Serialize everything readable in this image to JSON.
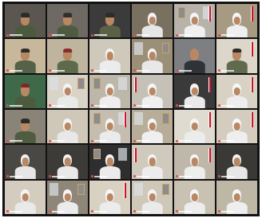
{
  "meeting": {
    "grid_columns": 6,
    "grid_rows": 6
  },
  "participants": [
    {
      "attire": "military-cap",
      "bg": "#5b5750",
      "body": "#4b5a3c",
      "head": "#2b2d28",
      "tag_visible": true
    },
    {
      "attire": "military-cap",
      "bg": "#6e6a63",
      "body": "#4f5b40",
      "head": "#2f312b",
      "tag_visible": true
    },
    {
      "attire": "military-cap",
      "bg": "#3b3b3b",
      "body": "#5a6146",
      "head": "#2c2b28",
      "tag_visible": true
    },
    {
      "attire": "ghutra-white",
      "bg": "#7a7060",
      "body": "#e6e6e6",
      "head": "#f2f2f2",
      "tag_visible": true
    },
    {
      "attire": "ghutra-white",
      "bg": "#b8b3aa",
      "body": "#f0f0f0",
      "head": "#f5f5f5",
      "tag_visible": true
    },
    {
      "attire": "ghutra-white",
      "bg": "#a79a83",
      "body": "#efefef",
      "head": "#f4f4f4",
      "tag_visible": true
    },
    {
      "attire": "military-cap",
      "bg": "#c7b89b",
      "body": "#566247",
      "head": "#2d2e2a",
      "tag_visible": true
    },
    {
      "attire": "military-cap",
      "bg": "#bfb59f",
      "body": "#5d6a4b",
      "head": "#8a2a2a",
      "tag_visible": true
    },
    {
      "attire": "ghutra-white",
      "bg": "#cfc9bc",
      "body": "#ececec",
      "head": "#f4f4f4",
      "tag_visible": true
    },
    {
      "attire": "ghutra-white",
      "bg": "#9c8f77",
      "body": "#e8e8e8",
      "head": "#f6f6f6",
      "tag_visible": true
    },
    {
      "attire": "suit",
      "bg": "#7d7f82",
      "body": "#2f3338",
      "head": "#3a3330",
      "tag_visible": true
    },
    {
      "attire": "military-cap",
      "bg": "#ddd6ca",
      "body": "#5f6b4c",
      "head": "#2b2c28",
      "tag_visible": true
    },
    {
      "attire": "military-cap",
      "bg": "#3f6a4a",
      "body": "#4c5a3e",
      "head": "#7b2a2a",
      "tag_visible": true
    },
    {
      "attire": "ghutra-white",
      "bg": "#d9d3c8",
      "body": "#e9e9e9",
      "head": "#f3f3f3",
      "tag_visible": true
    },
    {
      "attire": "ghutra-white",
      "bg": "#bdb7aa",
      "body": "#eeeeee",
      "head": "#f5f5f5",
      "tag_visible": true
    },
    {
      "attire": "ghutra-white",
      "bg": "#c6c1b6",
      "body": "#efefef",
      "head": "#f6f6f6",
      "tag_visible": true
    },
    {
      "attire": "ghutra-white",
      "bg": "#3a3a3a",
      "body": "#eaeaea",
      "head": "#f4f4f4",
      "tag_visible": true
    },
    {
      "attire": "ghutra-white",
      "bg": "#d8d2c4",
      "body": "#ededed",
      "head": "#f6f6f6",
      "tag_visible": true
    },
    {
      "attire": "military-cap",
      "bg": "#8a8478",
      "body": "#4f5c40",
      "head": "#2b2c28",
      "tag_visible": true
    },
    {
      "attire": "ghutra-white",
      "bg": "#cfc8b8",
      "body": "#e8e8e8",
      "head": "#f4f4f4",
      "tag_visible": true
    },
    {
      "attire": "ghutra-white",
      "bg": "#c4bdb0",
      "body": "#ebebeb",
      "head": "#f5f5f5",
      "tag_visible": true
    },
    {
      "attire": "ghutra-white",
      "bg": "#b8ad98",
      "body": "#efefef",
      "head": "#f6f6f6",
      "tag_visible": true
    },
    {
      "attire": "ghutra-white",
      "bg": "#e0dbd0",
      "body": "#ececec",
      "head": "#f5f5f5",
      "tag_visible": true
    },
    {
      "attire": "ghutra-white",
      "bg": "#d3ccbf",
      "body": "#eeeeee",
      "head": "#f6f6f6",
      "tag_visible": true
    },
    {
      "attire": "ghutra-white",
      "bg": "#4a4844",
      "body": "#e6e6e6",
      "head": "#f2f2f2",
      "tag_visible": true
    },
    {
      "attire": "ghutra-white",
      "bg": "#3d3b38",
      "body": "#e9e9e9",
      "head": "#f3f3f3",
      "tag_visible": true
    },
    {
      "attire": "ghutra-white",
      "bg": "#2e2e2e",
      "body": "#ebebeb",
      "head": "#f5f5f5",
      "tag_visible": true
    },
    {
      "attire": "ghutra-white",
      "bg": "#cfc9be",
      "body": "#ececec",
      "head": "#f4f4f4",
      "tag_visible": true
    },
    {
      "attire": "ghutra-white",
      "bg": "#bfb8aa",
      "body": "#eeeeee",
      "head": "#f6f6f6",
      "tag_visible": true
    },
    {
      "attire": "ghutra-white",
      "bg": "#3a3936",
      "body": "#e7e7e7",
      "head": "#f3f3f3",
      "tag_visible": true
    },
    {
      "attire": "ghutra-white",
      "bg": "#d4cdbf",
      "body": "#e9e9e9",
      "head": "#f4f4f4",
      "tag_visible": true
    },
    {
      "attire": "ghutra-white",
      "bg": "#8e8678",
      "body": "#ebebeb",
      "head": "#f5f5f5",
      "tag_visible": true
    },
    {
      "attire": "ghutra-white",
      "bg": "#d9d2c3",
      "body": "#ececec",
      "head": "#f6f6f6",
      "tag_visible": true
    },
    {
      "attire": "ghutra-white",
      "bg": "#cfc7b8",
      "body": "#eaeaea",
      "head": "#f4f4f4",
      "tag_visible": true
    },
    {
      "attire": "ghutra-white",
      "bg": "#c9c1b1",
      "body": "#ededed",
      "head": "#f5f5f5",
      "tag_visible": true
    },
    {
      "attire": "ghutra-white",
      "bg": "#bfb7a6",
      "body": "#eeeeee",
      "head": "#f6f6f6",
      "tag_visible": true
    }
  ],
  "colors": {
    "grid_background": "#121212",
    "mic_indicator": "#e24b4b",
    "flag_red": "#ce1126"
  }
}
